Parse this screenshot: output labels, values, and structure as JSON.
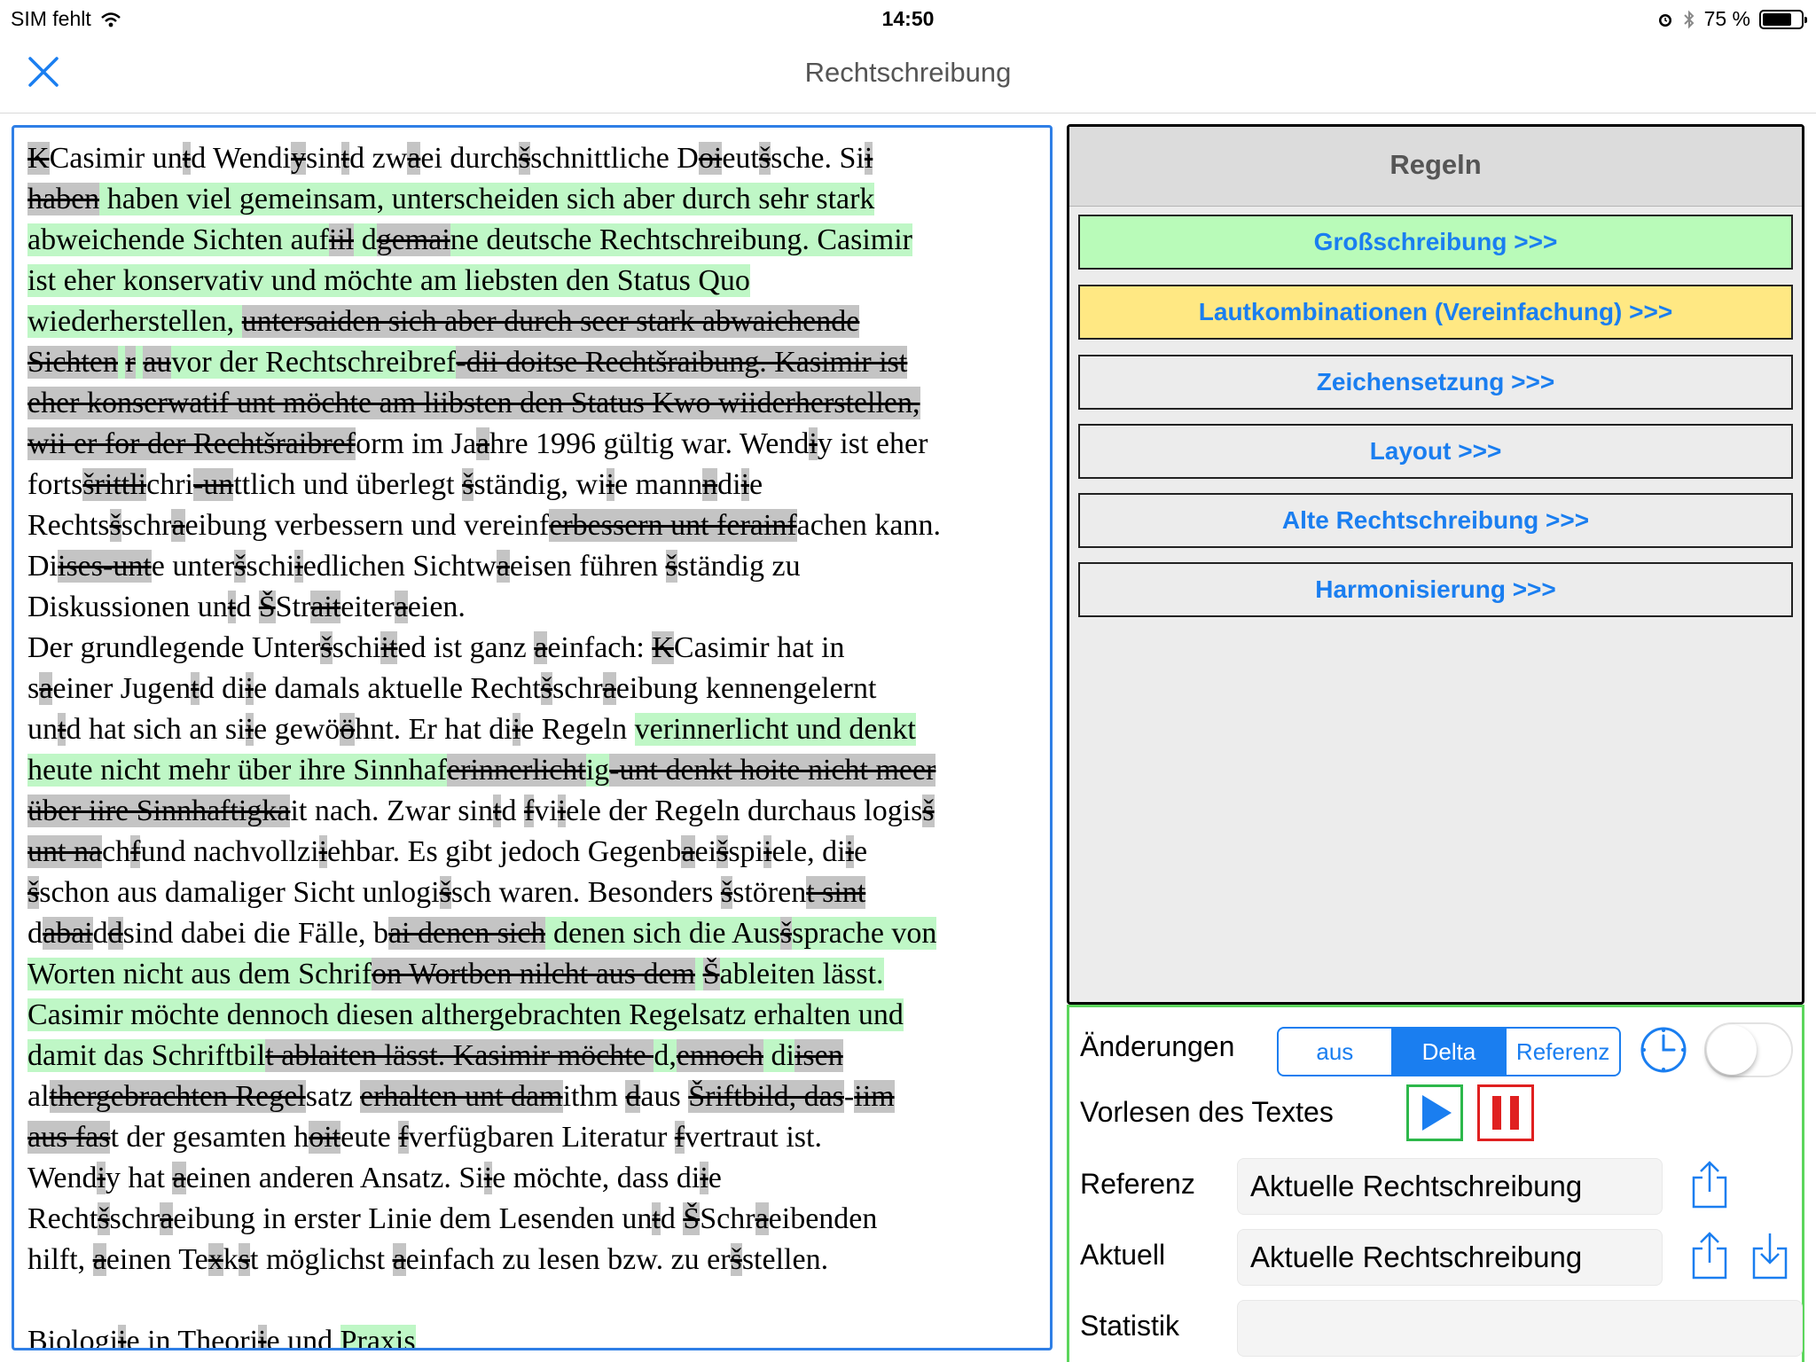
{
  "status_bar": {
    "carrier": "SIM fehlt",
    "time": "14:50",
    "battery_text": "75 %",
    "battery_level": 0.75
  },
  "nav": {
    "title": "Rechtschreibung",
    "close_icon": "close-icon"
  },
  "text": {
    "lines": [
      [
        [
          "d",
          "K"
        ],
        [
          "",
          "Casimir un"
        ],
        [
          "d",
          "t"
        ],
        [
          "",
          "d Wendi"
        ],
        [
          "d",
          "y"
        ],
        [
          "",
          "sin"
        ],
        [
          "d",
          "t"
        ],
        [
          "",
          "d zw"
        ],
        [
          "d",
          "a"
        ],
        [
          "",
          "ei durch"
        ],
        [
          "d",
          "š"
        ],
        [
          "",
          "schnittliche D"
        ],
        [
          "d",
          "oi"
        ],
        [
          "",
          "eut"
        ],
        [
          "d",
          "š"
        ],
        [
          "",
          "sche. Si"
        ],
        [
          "d",
          "i"
        ]
      ],
      [
        [
          "d",
          "haben"
        ],
        [
          "g",
          " haben viel gemeinsam, unterscheiden sich aber durch sehr stark"
        ]
      ],
      [
        [
          "g",
          "abweichende Sichten auf"
        ],
        [
          "d",
          "iil"
        ],
        [
          "g",
          " d"
        ],
        [
          "d",
          "gemai"
        ],
        [
          "g",
          "ne"
        ],
        [
          "g",
          " deutsche Rechtschreibung. Casimir"
        ]
      ],
      [
        [
          "g",
          "ist eher konservativ und möchte am liebsten den Status Quo"
        ]
      ],
      [
        [
          "g",
          "wiederherstellen, "
        ],
        [
          "d",
          "untersaiden sich aber durch seer stark abwaichende"
        ]
      ],
      [
        [
          "d",
          "Sichten"
        ],
        [
          "g",
          " "
        ],
        [
          "d",
          "r"
        ],
        [
          "g",
          " "
        ],
        [
          "d",
          "au"
        ],
        [
          "g",
          "vor der Rechtschreibref"
        ],
        [
          "d",
          "-dii doitse Rechtšraibung. Kasimir ist"
        ]
      ],
      [
        [
          "d",
          "eher konserwatif unt möchte am liibsten den Status Kwo wiiderherstellen,"
        ]
      ],
      [
        [
          "d",
          "wii er for der Rechtšraibref"
        ],
        [
          "",
          "orm im Ja"
        ],
        [
          "d",
          "a"
        ],
        [
          "",
          "hre 1996 gültig war. Wend"
        ],
        [
          "d",
          "i"
        ],
        [
          "",
          "y ist eher"
        ]
      ],
      [
        [
          "",
          "forts"
        ],
        [
          "d",
          "šrittli"
        ],
        [
          "",
          "chri"
        ],
        [
          "d",
          "-un"
        ],
        [
          "",
          "ttlich und überlegt "
        ],
        [
          "d",
          "š"
        ],
        [
          "",
          "ständig, wi"
        ],
        [
          "d",
          "i"
        ],
        [
          "",
          "e mann"
        ],
        [
          "d",
          "n"
        ],
        [
          "",
          "di"
        ],
        [
          "d",
          "i"
        ],
        [
          "",
          "e"
        ]
      ],
      [
        [
          "",
          "Rechts"
        ],
        [
          "d",
          "š"
        ],
        [
          "",
          "schr"
        ],
        [
          "d",
          "a"
        ],
        [
          "",
          "eibung verbessern und vereinf"
        ],
        [
          "d",
          "erbessern unt ferainf"
        ],
        [
          "",
          "achen kann."
        ]
      ],
      [
        [
          "",
          "Di"
        ],
        [
          "d",
          "ises"
        ],
        [
          "d",
          "-unt"
        ],
        [
          "",
          "e unter"
        ],
        [
          "d",
          "š"
        ],
        [
          "",
          "schi"
        ],
        [
          "d",
          "i"
        ],
        [
          "",
          "edlichen Sichtw"
        ],
        [
          "d",
          "a"
        ],
        [
          "",
          "eisen führen "
        ],
        [
          "d",
          "š"
        ],
        [
          "",
          "ständig zu"
        ]
      ],
      [
        [
          "",
          "Diskussionen un"
        ],
        [
          "d",
          "t"
        ],
        [
          "",
          "d "
        ],
        [
          "d",
          "Š"
        ],
        [
          "",
          "Str"
        ],
        [
          "d",
          "ait"
        ],
        [
          "",
          "eiter"
        ],
        [
          "d",
          "a"
        ],
        [
          "",
          "eien."
        ]
      ],
      [
        [
          "",
          "Der grundlegende Unter"
        ],
        [
          "d",
          "š"
        ],
        [
          "",
          "schi"
        ],
        [
          "d",
          "it"
        ],
        [
          "",
          "ed ist ganz "
        ],
        [
          "d",
          "a"
        ],
        [
          "",
          "einfach: "
        ],
        [
          "d",
          "K"
        ],
        [
          "",
          "Casimir hat in"
        ]
      ],
      [
        [
          "",
          "s"
        ],
        [
          "d",
          "a"
        ],
        [
          "",
          "einer Jugen"
        ],
        [
          "d",
          "t"
        ],
        [
          "",
          "d di"
        ],
        [
          "d",
          "i"
        ],
        [
          "",
          "e damals aktuelle Recht"
        ],
        [
          "d",
          "š"
        ],
        [
          "",
          "schr"
        ],
        [
          "d",
          "a"
        ],
        [
          "",
          "eibung kennengelernt"
        ]
      ],
      [
        [
          "",
          "un"
        ],
        [
          "d",
          "t"
        ],
        [
          "",
          "d hat sich an si"
        ],
        [
          "d",
          "i"
        ],
        [
          "",
          "e gewö"
        ],
        [
          "d",
          "ö"
        ],
        [
          "",
          "hnt. Er hat di"
        ],
        [
          "d",
          "i"
        ],
        [
          "",
          "e Regeln "
        ],
        [
          "g",
          "verinnerlicht und denkt"
        ]
      ],
      [
        [
          "g",
          "heute nicht mehr über ihre Sinnhaf"
        ],
        [
          "d",
          "erinnerlicht"
        ],
        [
          "g",
          "ig"
        ],
        [
          "d",
          "-unt denkt hoite nicht meer"
        ]
      ],
      [
        [
          "d",
          "über iire Sinnhaftigka"
        ],
        [
          "",
          "it nach. Zwar sin"
        ],
        [
          "d",
          "t"
        ],
        [
          "",
          "d "
        ],
        [
          "d",
          "f"
        ],
        [
          "",
          "vi"
        ],
        [
          "d",
          "i"
        ],
        [
          "",
          "ele der Regeln durchaus logis"
        ],
        [
          "d",
          "š"
        ]
      ],
      [
        [
          "d",
          "unt na"
        ],
        [
          "",
          "ch"
        ],
        [
          "d",
          "f"
        ],
        [
          "",
          "und nachvollzi"
        ],
        [
          "d",
          "i"
        ],
        [
          "",
          "ehbar. Es gibt jedoch Gegenb"
        ],
        [
          "d",
          "a"
        ],
        [
          "",
          "ei"
        ],
        [
          "d",
          "š"
        ],
        [
          "",
          "spi"
        ],
        [
          "d",
          "i"
        ],
        [
          "",
          "ele, di"
        ],
        [
          "d",
          "i"
        ],
        [
          "",
          "e"
        ]
      ],
      [
        [
          "d",
          "š"
        ],
        [
          "",
          "schon aus damaliger Sicht unlogi"
        ],
        [
          "d",
          "š"
        ],
        [
          "",
          "sch waren. Besonders "
        ],
        [
          "d",
          "š"
        ],
        [
          "",
          "stören"
        ],
        [
          "d",
          "t sint"
        ]
      ],
      [
        [
          "",
          "d"
        ],
        [
          "d",
          "abai"
        ],
        [
          "",
          "d"
        ],
        [
          "d",
          "d"
        ],
        [
          "",
          "sind dabei die Fälle, b"
        ],
        [
          "d",
          "ai denen sich"
        ],
        [
          "g",
          " denen sich die Aus"
        ],
        [
          "d",
          "š"
        ],
        [
          "g",
          "sprache von"
        ]
      ],
      [
        [
          "g",
          "Worten nicht aus dem Schrif"
        ],
        [
          "d",
          "on Wortben nilcht aus dem"
        ],
        [
          "g",
          " "
        ],
        [
          "d",
          "Š"
        ],
        [
          "g",
          "ableiten lässt."
        ]
      ],
      [
        [
          "g",
          "Casimir möchte dennoch diesen althergebrachten Regelsatz erhalten und"
        ]
      ],
      [
        [
          "g",
          "damit das Schriftbil"
        ],
        [
          "d",
          "t ablaiten lässt. Kasimir möchte "
        ],
        [
          "g",
          "d,"
        ],
        [
          "d",
          "ennoch"
        ],
        [
          "g",
          " di"
        ],
        [
          "d",
          "isen"
        ]
      ],
      [
        [
          "",
          "al"
        ],
        [
          "d",
          "thergebrachten Regel"
        ],
        [
          "",
          "satz "
        ],
        [
          "d",
          "erhalten unt dam"
        ],
        [
          "",
          "ithm "
        ],
        [
          "d",
          "d"
        ],
        [
          "",
          "aus "
        ],
        [
          "d",
          "Šriftbild, das"
        ],
        [
          "",
          "-"
        ],
        [
          "d",
          "iim"
        ]
      ],
      [
        [
          "d",
          "aus fas"
        ],
        [
          "",
          "t der gesamten h"
        ],
        [
          "d",
          "oit"
        ],
        [
          "",
          "eute "
        ],
        [
          "d",
          "f"
        ],
        [
          "",
          "verfügbaren Literatur "
        ],
        [
          "d",
          "f"
        ],
        [
          "",
          "vertraut ist."
        ]
      ],
      [
        [
          "",
          "Wend"
        ],
        [
          "d",
          "i"
        ],
        [
          "",
          "y hat "
        ],
        [
          "d",
          "a"
        ],
        [
          "",
          "einen anderen Ansatz. Si"
        ],
        [
          "d",
          "i"
        ],
        [
          "",
          "e möchte, dass di"
        ],
        [
          "d",
          "i"
        ],
        [
          "",
          "e"
        ]
      ],
      [
        [
          "",
          "Recht"
        ],
        [
          "d",
          "š"
        ],
        [
          "",
          "schr"
        ],
        [
          "d",
          "a"
        ],
        [
          "",
          "eibung in erster Linie dem Lesenden un"
        ],
        [
          "d",
          "t"
        ],
        [
          "",
          "d "
        ],
        [
          "d",
          "Š"
        ],
        [
          "",
          "Schr"
        ],
        [
          "d",
          "a"
        ],
        [
          "",
          "eibenden"
        ]
      ],
      [
        [
          "",
          "hilft, "
        ],
        [
          "d",
          "a"
        ],
        [
          "",
          "einen Te"
        ],
        [
          "d",
          "x"
        ],
        [
          "",
          "k"
        ],
        [
          "d",
          "s"
        ],
        [
          "",
          "t möglichst "
        ],
        [
          "d",
          "a"
        ],
        [
          "",
          "einfach zu lesen bzw. zu er"
        ],
        [
          "d",
          "š"
        ],
        [
          "",
          "stellen."
        ]
      ],
      [
        [
          "",
          ""
        ]
      ],
      [
        [
          "",
          "Biologi"
        ],
        [
          "d",
          "i"
        ],
        [
          "",
          "e in Theori"
        ],
        [
          "d",
          "i"
        ],
        [
          "",
          "e und "
        ],
        [
          "g",
          "Praxis"
        ]
      ]
    ]
  },
  "rules": {
    "title": "Regeln",
    "buttons": [
      {
        "label": "Großschreibung >>>",
        "color": "#b9fbb9"
      },
      {
        "label": "Lautkombinationen (Vereinfachung) >>>",
        "color": "#ffe883"
      },
      {
        "label": "Zeichensetzung >>>",
        "color": "#ececec"
      },
      {
        "label": "Layout >>>",
        "color": "#ececec"
      },
      {
        "label": "Alte Rechtschreibung >>>",
        "color": "#ececec"
      },
      {
        "label": "Harmonisierung >>>",
        "color": "#ececec"
      }
    ]
  },
  "controls": {
    "changes_label": "Änderungen",
    "segments": [
      "aus",
      "Delta",
      "Referenz"
    ],
    "selected_segment": "Delta",
    "toggle_on": false,
    "read_aloud_label": "Vorlesen des Textes",
    "reference_label": "Referenz",
    "reference_value": "Aktuelle Rechtschreibung",
    "current_label": "Aktuell",
    "current_value": "Aktuelle Rechtschreibung",
    "statistics_label": "Statistik",
    "statistics_value": ""
  },
  "colors": {
    "accent": "#1a7ef0",
    "added_highlight": "#bff7c6",
    "removed_highlight": "#c4c4c4",
    "active_rule": "#b9fbb9",
    "warning_rule": "#ffe883",
    "play": "#2db84b",
    "pause": "#e02020",
    "panel_border": "#5cd65c"
  }
}
